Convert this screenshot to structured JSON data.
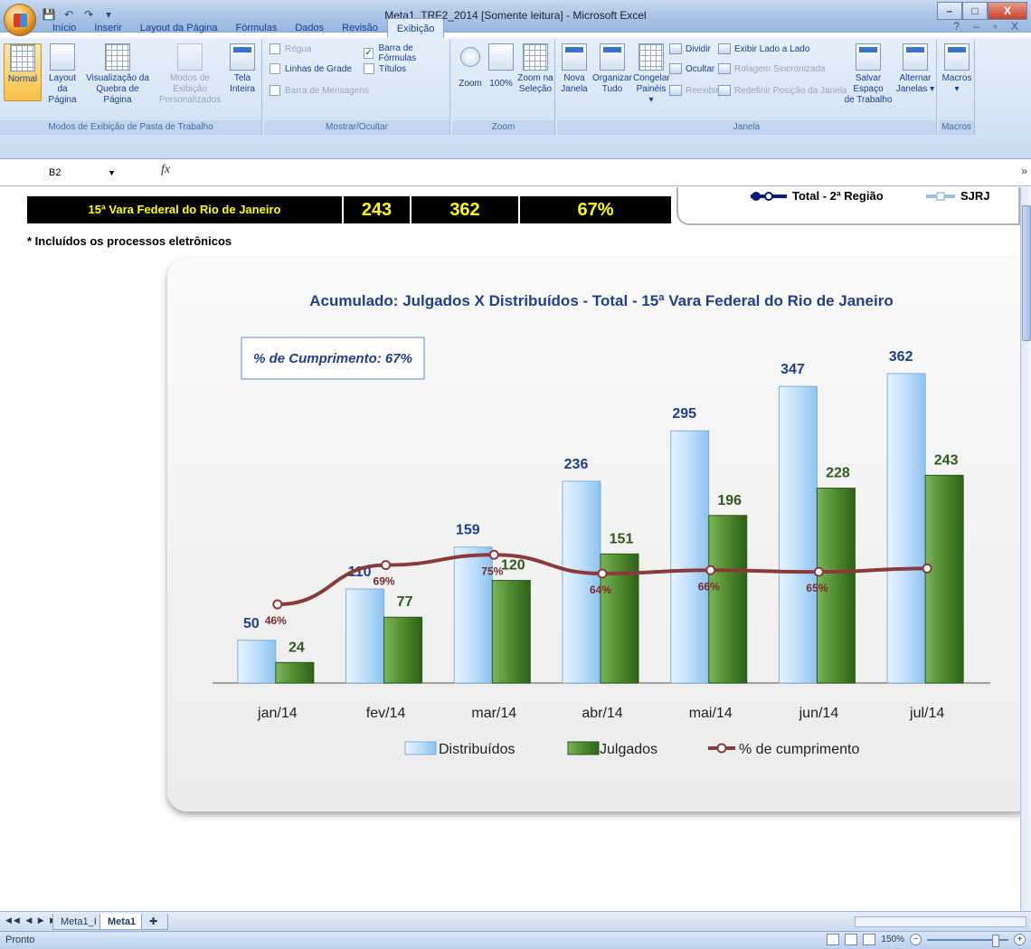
{
  "window": {
    "title": "Meta1_TRF2_2014  [Somente leitura] - Microsoft Excel",
    "controls": [
      "–",
      "□",
      "X"
    ]
  },
  "ribbon": {
    "tabs": [
      "Início",
      "Inserir",
      "Layout da Página",
      "Fórmulas",
      "Dados",
      "Revisão",
      "Exibição"
    ],
    "active_tab": "Exibição",
    "right_controls": "? – ▫ X",
    "groups": {
      "modos": {
        "label": "Modos de Exibição de Pasta de Trabalho",
        "normal": "Normal",
        "layout1": "Layout da",
        "layout2": "Página",
        "quebra1": "Visualização da",
        "quebra2": "Quebra de Página",
        "pers1": "Modos de Exibição",
        "pers2": "Personalizados",
        "tela1": "Tela",
        "tela2": "Inteira"
      },
      "mostrar": {
        "label": "Mostrar/Ocultar",
        "regua": "Régua",
        "linhas": "Linhas de Grade",
        "mensagens": "Barra de Mensagens",
        "formulas": "Barra de Fórmulas",
        "titulos": "Títulos"
      },
      "zoom": {
        "label": "Zoom",
        "zoom": "Zoom",
        "cem": "100%",
        "sel1": "Zoom na",
        "sel2": "Seleção"
      },
      "janela": {
        "label": "Janela",
        "nova1": "Nova",
        "nova2": "Janela",
        "org1": "Organizar",
        "org2": "Tudo",
        "cong1": "Congelar",
        "cong2": "Painéis ▾",
        "dividir": "Dividir",
        "ocultar": "Ocultar",
        "reexibir": "Reexibir",
        "lado": "Exibir Lado a Lado",
        "rolagem": "Rolagem Sincronizada",
        "redefinir": "Redefinir Posição da Janela",
        "salvar1": "Salvar Espaço",
        "salvar2": "de Trabalho",
        "alt1": "Alternar",
        "alt2": "Janelas ▾"
      },
      "macros": {
        "label": "Macros",
        "macros": "Macros"
      }
    }
  },
  "formula_bar": {
    "cell": "B2",
    "fx": "fx",
    "value": ""
  },
  "sheet": {
    "row_name": "15ª Vara Federal do Rio de Janeiro",
    "julgados": "243",
    "distribuidos": "362",
    "percent": "67%",
    "legend_total": "Total - 2ª Região",
    "legend_sjrj": "SJRJ",
    "note": "* Incluídos os processos eletrônicos"
  },
  "chart_data": {
    "type": "bar",
    "title": "Acumulado: Julgados X Distribuídos  -  Total   -  15ª Vara Federal do Rio de Janeiro",
    "annotation": "% de Cumprimento: 67%",
    "categories": [
      "jan/14",
      "fev/14",
      "mar/14",
      "abr/14",
      "mai/14",
      "jun/14",
      "jul/14"
    ],
    "series": [
      {
        "name": "Distribuídos",
        "values": [
          50,
          110,
          159,
          236,
          295,
          347,
          362
        ],
        "color": "#bfe0fb"
      },
      {
        "name": "Julgados",
        "values": [
          24,
          77,
          120,
          151,
          196,
          228,
          243
        ],
        "color": "#4e8a2e"
      },
      {
        "name": "% de cumprimento",
        "values": [
          46,
          69,
          75,
          64,
          66,
          65,
          67
        ],
        "labels": [
          "46%",
          "69%",
          "75%",
          "64%",
          "66%",
          "65%",
          ""
        ],
        "type": "line",
        "color": "#8b3a3a"
      }
    ],
    "ylim": [
      0,
      400
    ],
    "grid": false,
    "legend": "bottom"
  },
  "sheet_tabs": {
    "tabs": [
      "Meta1_I",
      "Meta1"
    ],
    "active": "Meta1"
  },
  "status": {
    "text": "Pronto",
    "zoom": "150%"
  },
  "colors": {
    "title_bar": "#a9c4e6",
    "ribbon": "#d4e3f5",
    "black_bar_text": "#ffff00",
    "chart_title": "#1f3f8f",
    "distribuidos_label": "#1f3f8f",
    "julgados_label": "#2f5a1a",
    "line": "#8b3a3a"
  }
}
